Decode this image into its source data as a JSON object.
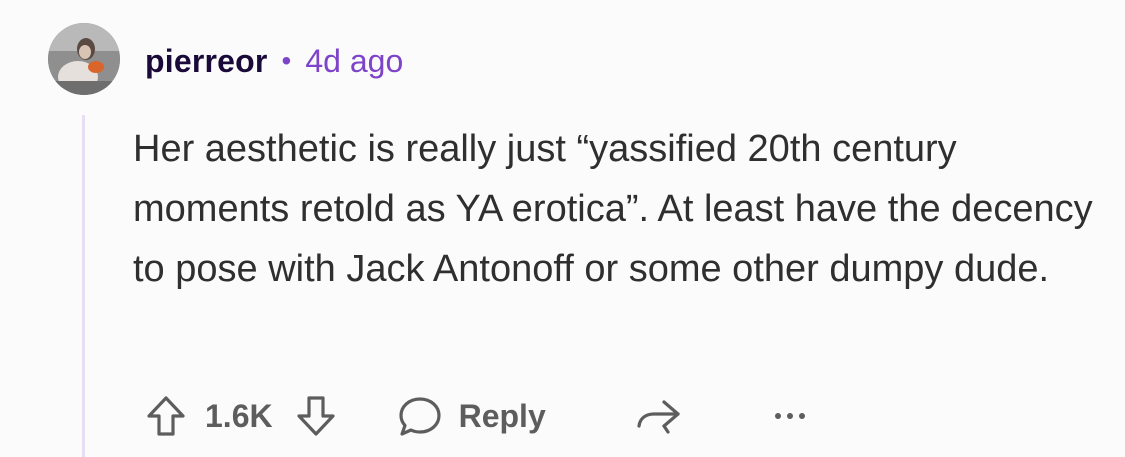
{
  "comment": {
    "author": "pierreor",
    "separator": "•",
    "timestamp": "4d ago",
    "body": "Her aesthetic is really just “yassified 20th century moments retold as YA erotica”. At least have the decency to pose with Jack Antonoff or some other dumpy dude.",
    "vote_count": "1.6K",
    "reply_label": "Reply"
  },
  "icons": {
    "upvote": "arrow-up-outline-icon",
    "downvote": "arrow-down-outline-icon",
    "reply": "speech-bubble-icon",
    "share": "share-arrow-icon",
    "more": "ellipsis-icon"
  },
  "colors": {
    "username": "#1a0a3a",
    "timestamp": "#7d44c9",
    "body_text": "#2f2f2f",
    "actions": "#5d5d5d",
    "thread_line": "#e7def3"
  }
}
